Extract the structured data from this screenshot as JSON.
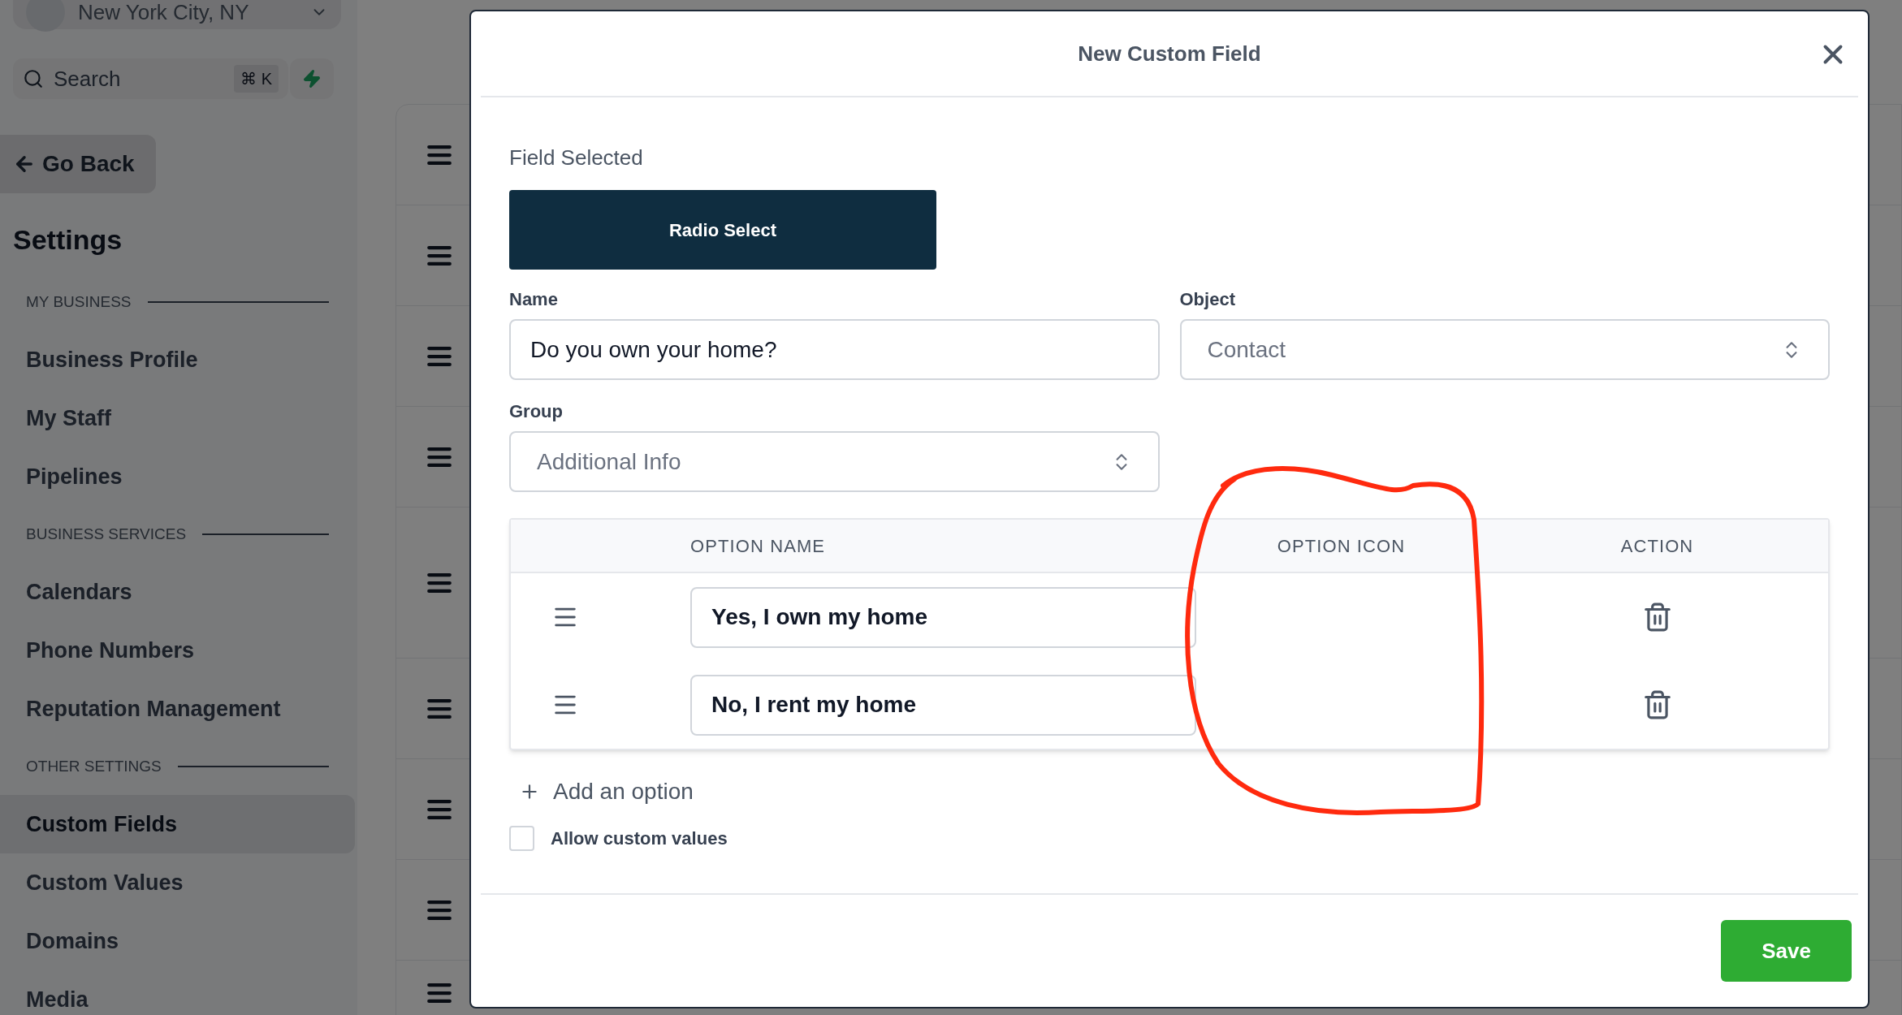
{
  "sidebar": {
    "location": "New York City, NY",
    "search": {
      "placeholder": "Search",
      "shortcut": "⌘ K"
    },
    "go_back": "Go Back",
    "title": "Settings",
    "sections": [
      {
        "heading": "MY BUSINESS",
        "items": [
          {
            "label": "Business Profile",
            "selected": false
          },
          {
            "label": "My Staff",
            "selected": false
          },
          {
            "label": "Pipelines",
            "selected": false
          }
        ]
      },
      {
        "heading": "BUSINESS SERVICES",
        "items": [
          {
            "label": "Calendars",
            "selected": false
          },
          {
            "label": "Phone Numbers",
            "selected": false
          },
          {
            "label": "Reputation Management",
            "selected": false
          }
        ]
      },
      {
        "heading": "OTHER SETTINGS",
        "items": [
          {
            "label": "Custom Fields",
            "selected": true
          },
          {
            "label": "Custom Values",
            "selected": false
          },
          {
            "label": "Domains",
            "selected": false
          },
          {
            "label": "Media",
            "selected": false
          }
        ]
      }
    ]
  },
  "modal": {
    "title": "New Custom Field",
    "field_selected_label": "Field Selected",
    "field_type": "Radio Select",
    "name": {
      "label": "Name",
      "value": "Do you own your home?"
    },
    "object": {
      "label": "Object",
      "value": "Contact"
    },
    "group": {
      "label": "Group",
      "value": "Additional Info"
    },
    "table": {
      "columns": [
        "OPTION NAME",
        "OPTION ICON",
        "ACTION"
      ],
      "rows": [
        {
          "option_name": "Yes, I own my home"
        },
        {
          "option_name": "No, I rent my home"
        }
      ]
    },
    "add_option": "Add an option",
    "allow_custom_values": {
      "label": "Allow custom values",
      "checked": false
    },
    "save": "Save"
  }
}
